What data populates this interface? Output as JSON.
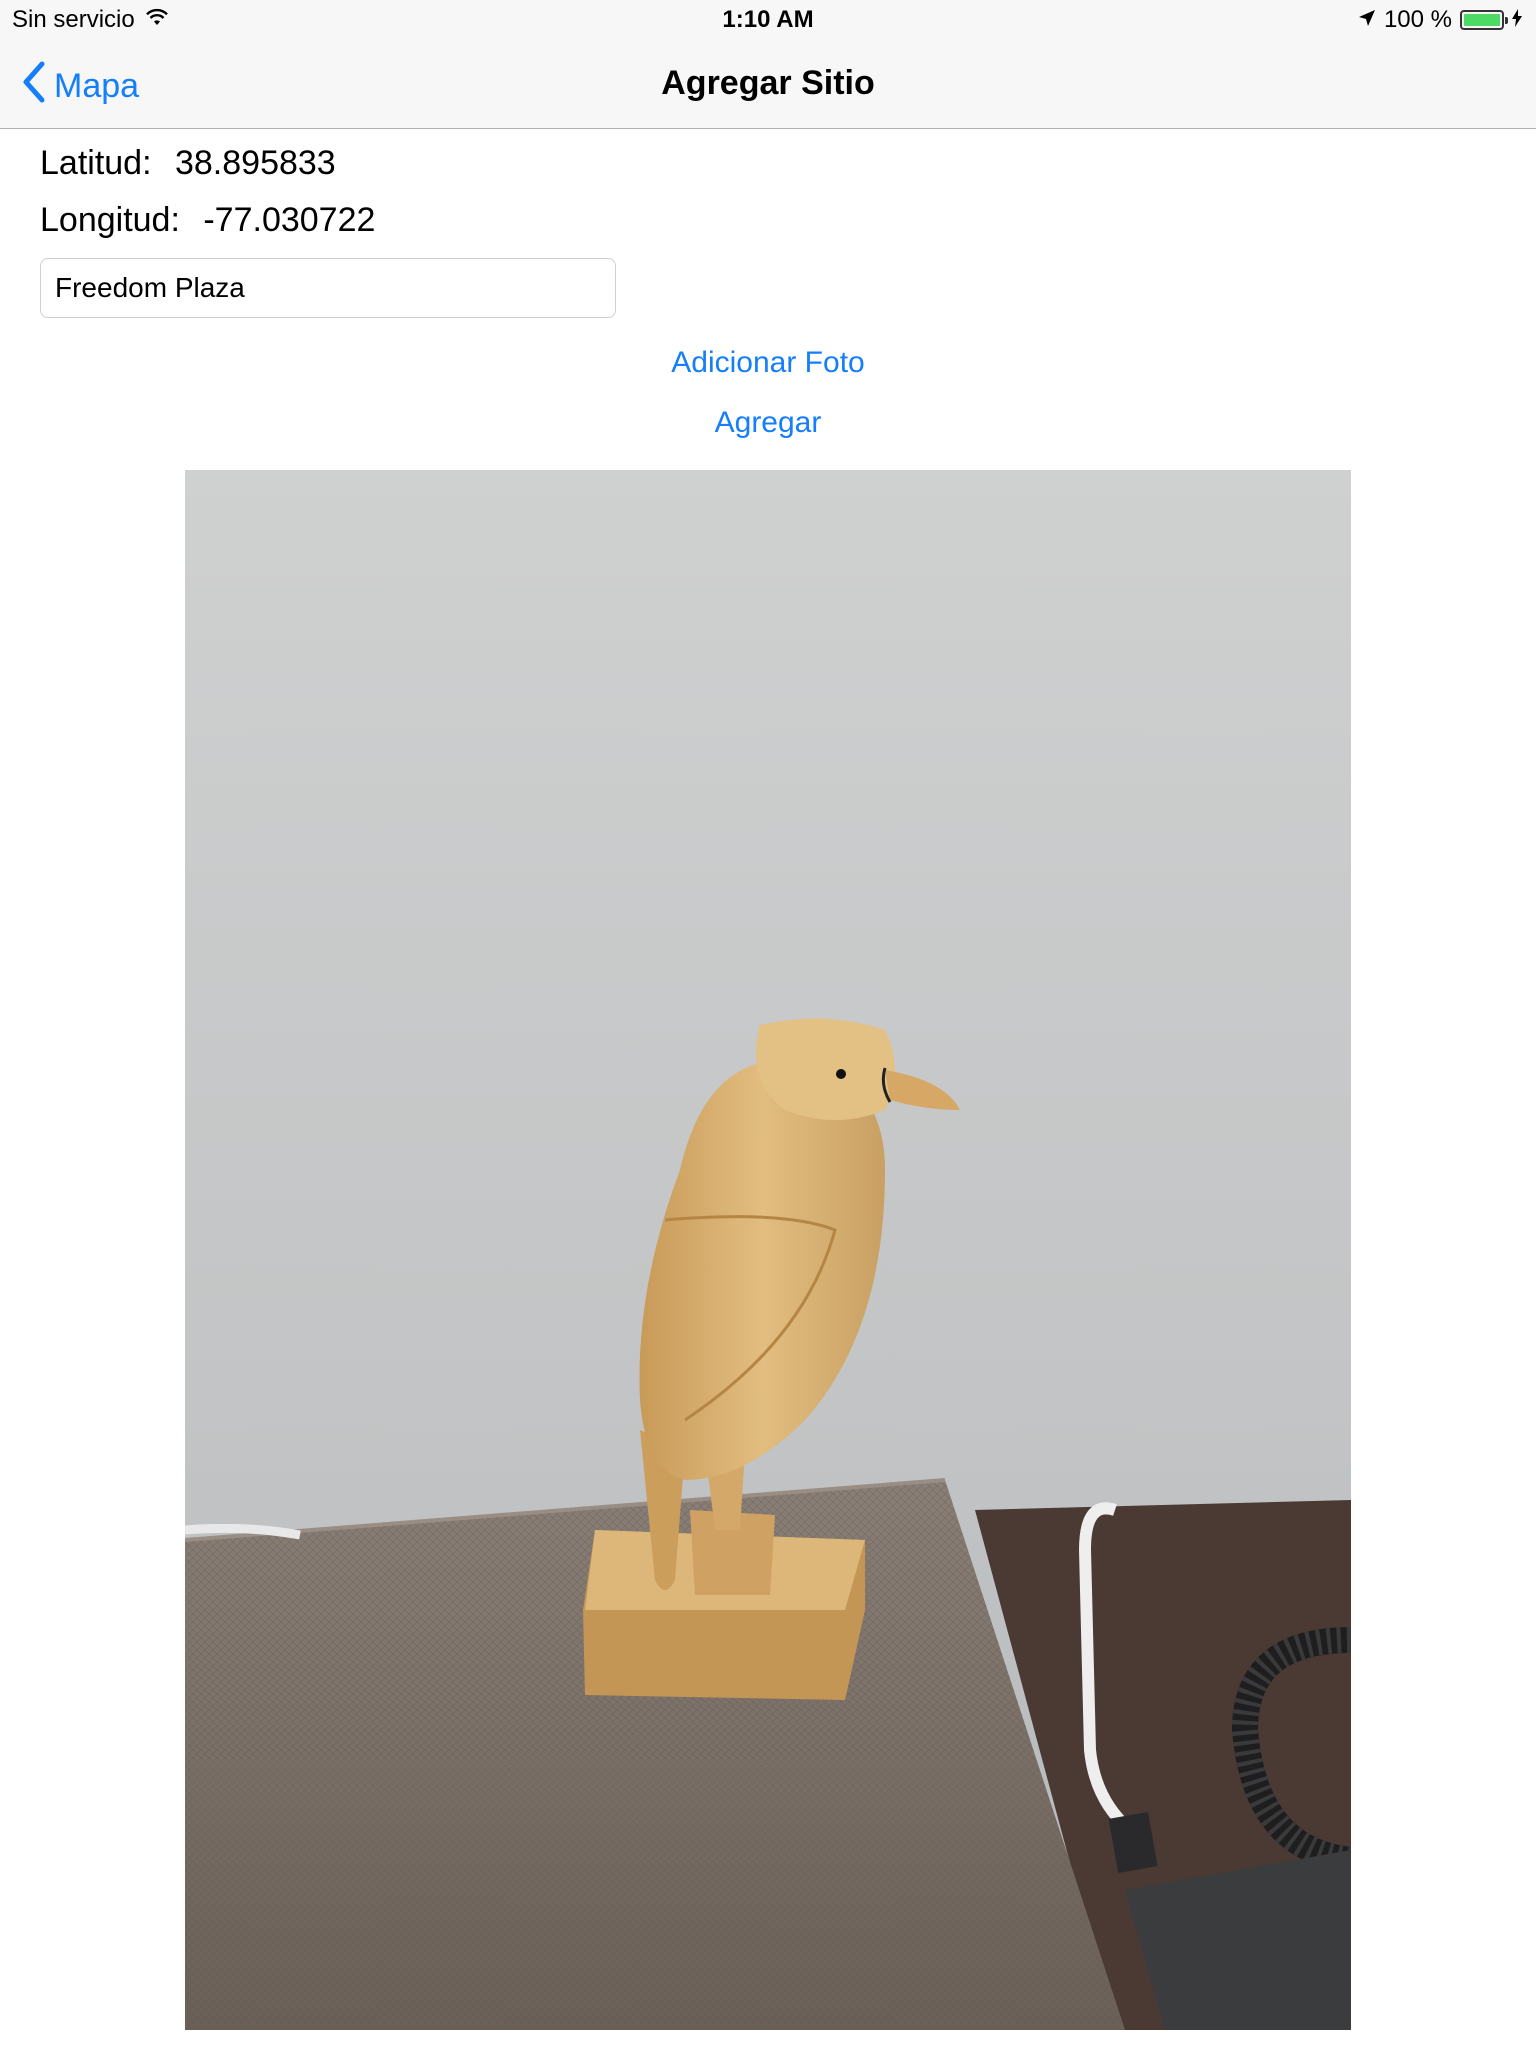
{
  "status_bar": {
    "carrier": "Sin servicio",
    "time": "1:10 AM",
    "battery_text": "100 %",
    "battery_level": 1.0,
    "icons": [
      "wifi-icon",
      "location-arrow-icon",
      "battery-icon",
      "charging-bolt-icon"
    ]
  },
  "nav": {
    "back_label": "Mapa",
    "title": "Agregar Sitio"
  },
  "coords": {
    "lat_label": "Latitud:",
    "lat_value": "38.895833",
    "lng_label": "Longitud:",
    "lng_value": "-77.030722"
  },
  "name_field": {
    "value": "Freedom Plaza"
  },
  "actions": {
    "add_photo": "Adicionar Foto",
    "add": "Agregar"
  },
  "colors": {
    "accent": "#147efb",
    "bar_background": "#f7f7f7",
    "battery": "#4cd964"
  }
}
